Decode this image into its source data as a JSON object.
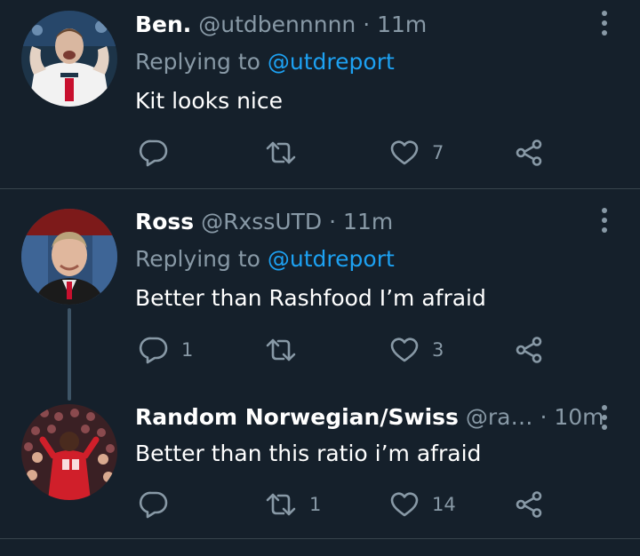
{
  "tweets": [
    {
      "name": "Ben.",
      "handle": "@utdbennnnn",
      "dot": "·",
      "time": "11m",
      "replying_label": "Replying to",
      "replying_to": "@utdreport",
      "text": "Kit looks nice",
      "replies": "",
      "retweets": "",
      "likes": "7"
    },
    {
      "name": "Ross",
      "handle": "@RxssUTD",
      "dot": "·",
      "time": "11m",
      "replying_label": "Replying to",
      "replying_to": "@utdreport",
      "text": "Better than Rashfood I’m afraid",
      "replies": "1",
      "retweets": "",
      "likes": "3"
    },
    {
      "name": "Random Norwegian/Swiss",
      "handle": "@ra…",
      "dot": "·",
      "time": "10m",
      "text": "Better than this ratio i’m afraid",
      "replies": "",
      "retweets": "1",
      "likes": "14"
    }
  ],
  "icons": {
    "reply": "reply-icon",
    "retweet": "retweet-icon",
    "like": "heart-icon",
    "share": "share-icon",
    "more": "more-vertical-icon"
  },
  "colors": {
    "background": "#15202b",
    "secondary_text": "#8899a6",
    "link": "#1da1f2",
    "divider": "#38444d",
    "thread_line": "#3d5466"
  }
}
